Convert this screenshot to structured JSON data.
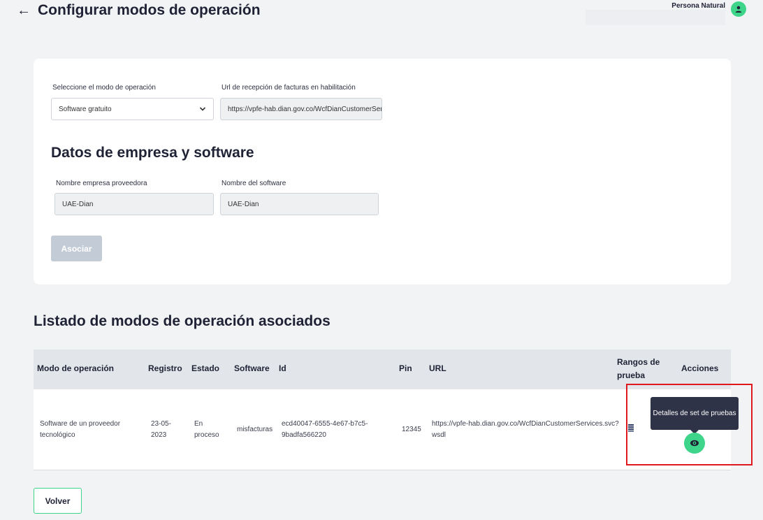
{
  "header": {
    "title": "Configurar modos de operación",
    "user_label": "Persona Natural"
  },
  "form": {
    "mode_label": "Seleccione el modo de operación",
    "mode_value": "Software gratuito",
    "url_label": "Url de recepción de facturas en habilitación",
    "url_value": "https://vpfe-hab.dian.gov.co/WcfDianCustomerServi",
    "section_title": "Datos de empresa y software",
    "provider_label": "Nombre empresa proveedora",
    "provider_value": "UAE-Dian",
    "software_label": "Nombre del software",
    "software_value": "UAE-Dian",
    "associate_button": "Asociar"
  },
  "list": {
    "title": "Listado de modos de operación asociados",
    "columns": {
      "mode": "Modo de operación",
      "registro": "Registro",
      "estado": "Estado",
      "software": "Software",
      "id": "Id",
      "pin": "Pin",
      "url": "URL",
      "rangos_1": "Rangos de",
      "rangos_2": "prueba",
      "acciones": "Acciones"
    },
    "rows": [
      {
        "mode_1": "Software de un proveedor",
        "mode_2": "tecnológico",
        "registro_1": "23-05-",
        "registro_2": "2023",
        "estado_1": "En",
        "estado_2": "proceso",
        "software": "misfacturas",
        "id_1": "ecd40047-6555-4e67-b7c5-",
        "id_2": "9badfa566220",
        "pin": "12345",
        "url_1": "https://vpfe-hab.dian.gov.co/WcfDianCustomerServices.svc?",
        "url_2": "wsdl"
      }
    ],
    "tooltip": "Detalles de set de pruebas"
  },
  "footer": {
    "back_button": "Volver"
  },
  "colors": {
    "accent": "#3ed48a",
    "highlight": "#e0191f",
    "tooltip_bg": "#2e3347"
  }
}
